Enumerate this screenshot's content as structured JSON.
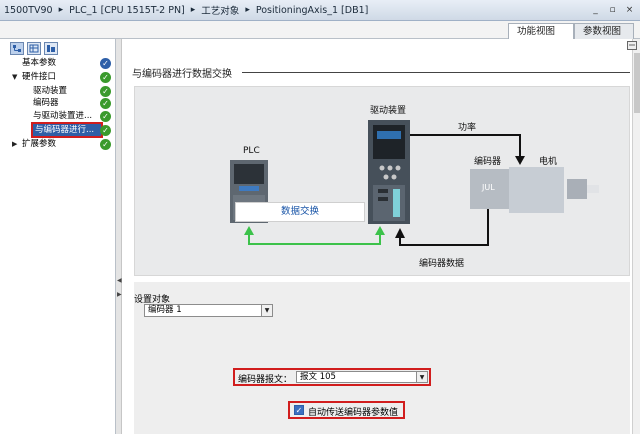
{
  "breadcrumb": {
    "items": [
      "1500TV90",
      "PLC_1 [CPU 1515T-2 PN]",
      "工艺对象",
      "PositioningAxis_1 [DB1]"
    ],
    "separator": "▸"
  },
  "window_controls": [
    "_",
    "▫",
    "×"
  ],
  "tabs": [
    {
      "label": "功能视图",
      "active": true
    },
    {
      "label": "参数视图",
      "active": false
    }
  ],
  "nav": {
    "tools": [
      "tree-view-icon",
      "list-view-icon",
      "hierarchy-view-icon"
    ],
    "items": [
      {
        "label": "基本参数",
        "status": "blue-check",
        "expanded": null
      },
      {
        "label": "硬件接口",
        "status": "green-check",
        "expanded": true
      },
      {
        "label": "驱动装置",
        "status": "green-check",
        "expanded": null
      },
      {
        "label": "编码器",
        "status": "green-check",
        "expanded": null
      },
      {
        "label": "与驱动装置进...",
        "status": "green-check",
        "expanded": null
      },
      {
        "label": "与编码器进行...",
        "status": "green-check",
        "expanded": null,
        "selected": true
      },
      {
        "label": "扩展参数",
        "status": "green-check",
        "expanded": false
      }
    ]
  },
  "main": {
    "section_title": "与编码器进行数据交换",
    "diagram": {
      "plc_label": "PLC",
      "drive_label": "驱动装置",
      "power_label": "功率",
      "encoder_label": "编码器",
      "motor_label": "电机",
      "encoder_data_label": "编码器数据",
      "exchange_label": "数据交换",
      "encoder_chip_text": "JUL"
    },
    "setting": {
      "object_label": "设置对象",
      "object_value": "编码器 1"
    },
    "telegram": {
      "label": "编码器报文：",
      "value": "报文 105"
    },
    "auto_transfer": {
      "label": "自动传送编码器参数值",
      "checked": true
    }
  },
  "colors": {
    "highlight": "#d11d1d",
    "selection": "#2f5ea6",
    "ok_check": "#3a9a2c",
    "exchange_line": "#3cc24a"
  }
}
